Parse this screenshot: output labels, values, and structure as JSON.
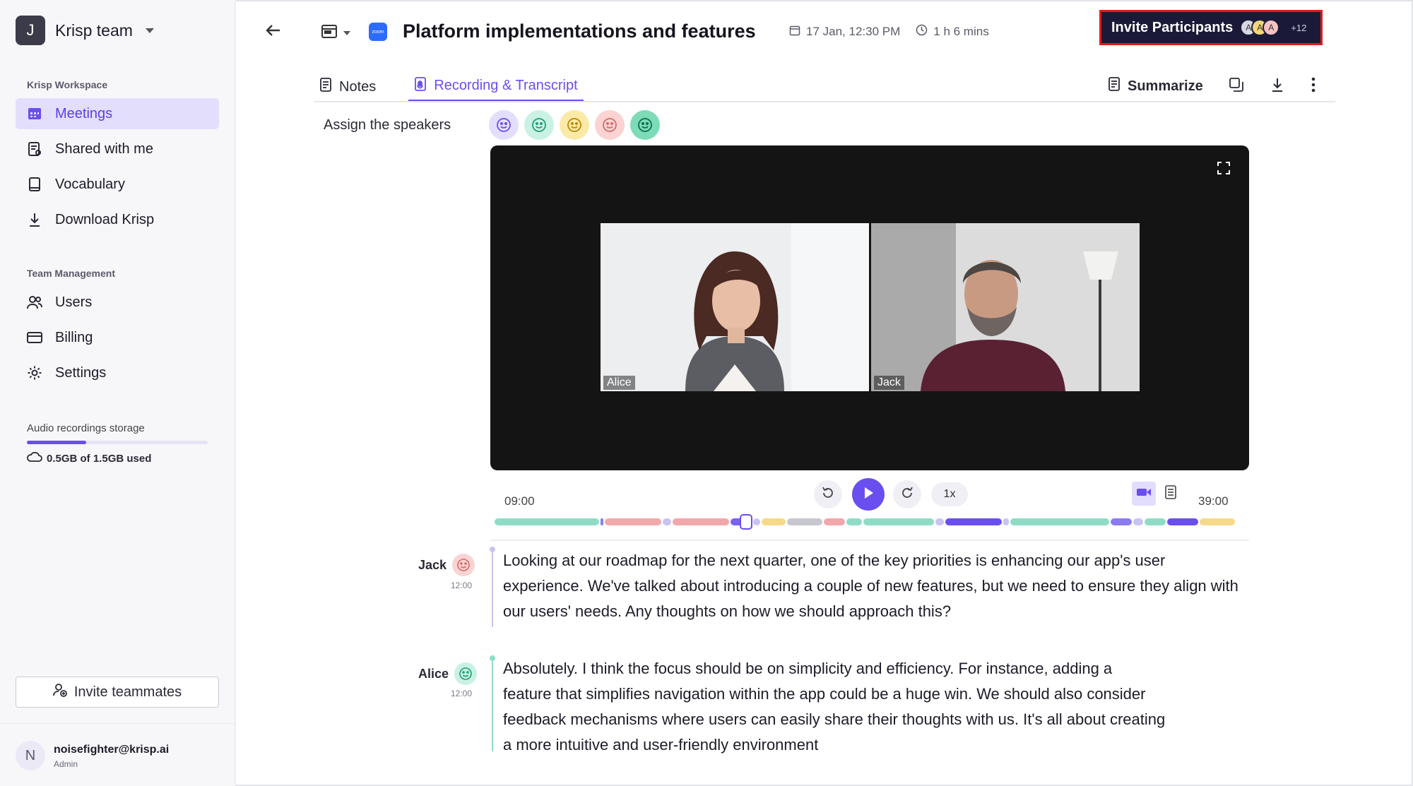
{
  "sidebar": {
    "team_initial": "J",
    "team_name": "Krisp team",
    "workspace_title": "Krisp Workspace",
    "workspace_items": [
      {
        "label": "Meetings",
        "icon": "calendar-icon",
        "active": true
      },
      {
        "label": "Shared with me",
        "icon": "shared-doc-icon",
        "active": false
      },
      {
        "label": "Vocabulary",
        "icon": "book-icon",
        "active": false
      },
      {
        "label": "Download Krisp",
        "icon": "download-icon",
        "active": false
      }
    ],
    "team_title": "Team Management",
    "team_items": [
      {
        "label": "Users",
        "icon": "users-icon"
      },
      {
        "label": "Billing",
        "icon": "card-icon"
      },
      {
        "label": "Settings",
        "icon": "gear-icon"
      }
    ],
    "storage_label": "Audio recordings storage",
    "storage_used_text": "0.5GB of 1.5GB used",
    "storage_fraction": 0.33,
    "invite_teammates": "Invite teammates",
    "user_initial": "N",
    "user_email": "noisefighter@krisp.ai",
    "user_role": "Admin"
  },
  "header": {
    "zoom_logo_text": "zoom",
    "title": "Platform implementations and features",
    "date": "17 Jan, 12:30 PM",
    "duration": "1 h 6 mins",
    "invite_label": "Invite Participants",
    "participants": [
      {
        "initial": "A",
        "color": "#d8d8e4"
      },
      {
        "initial": "A",
        "color": "#f5d67a"
      },
      {
        "initial": "A",
        "color": "#f6c2c2"
      }
    ],
    "participants_more": "+12"
  },
  "tabs": [
    {
      "label": "Notes",
      "icon": "notes-icon",
      "active": false
    },
    {
      "label": "Recording & Transcript",
      "icon": "recording-icon",
      "active": true
    }
  ],
  "tools": {
    "summarize": "Summarize"
  },
  "speakers": {
    "assign_label": "Assign the speakers",
    "faces": [
      "#e4defd",
      "#c9f1e4",
      "#fbe9a8",
      "#fbd3d3",
      "#7ddcb7"
    ]
  },
  "video": {
    "participants": [
      {
        "name": "Alice"
      },
      {
        "name": "Jack"
      }
    ]
  },
  "player": {
    "current_time": "09:00",
    "end_time": "39:00",
    "speed": "1x",
    "position_fraction": 0.34
  },
  "transcript": [
    {
      "speaker": "Jack",
      "time": "12:00",
      "face_color": "#fbd3d3",
      "bar_color": "#c9c3f0",
      "lines": [
        "Looking at our roadmap for the next quarter, one of the key priorities is enhancing our app's user",
        "experience. We've talked about introducing a couple of new features, but we need to ensure they align with",
        "our users' needs. Any thoughts on how we should approach this?"
      ]
    },
    {
      "speaker": "Alice",
      "time": "12:00",
      "face_color": "#c9f1e4",
      "bar_color": "#8fdcc6",
      "lines": [
        "Absolutely. I think the focus should be on simplicity and efficiency. For instance, adding a",
        "feature that simplifies navigation within the app could be a huge win. We should also consider",
        "feedback mechanisms where users can easily share their thoughts with us. It's all about creating",
        "a more intuitive and user-friendly environment"
      ]
    }
  ]
}
